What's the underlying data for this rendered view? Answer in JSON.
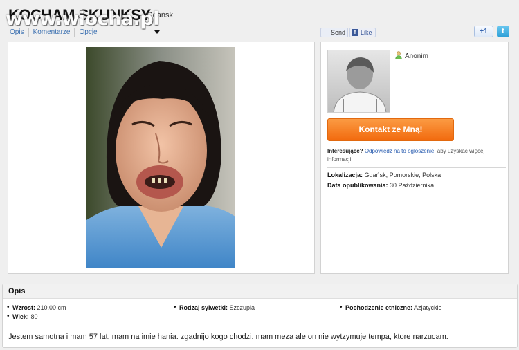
{
  "header": {
    "title": "KOCHAM SKUNKSY",
    "city": "— Gdańsk",
    "watermark": "www.wiocha.pl"
  },
  "tabs": [
    {
      "label": "Opis"
    },
    {
      "label": "Komentarze"
    },
    {
      "label": "Opcje"
    }
  ],
  "social": {
    "send_label": "Send",
    "like_label": "Like",
    "fb_glyph": "f",
    "gplus_label": "+1",
    "twitter_glyph": "t"
  },
  "profile": {
    "username": "Anonim",
    "contact_button": "Kontakt ze Mną!",
    "interest_bold": "Interesujące?",
    "interest_link": "Odpowiedz na to ogłoszenie",
    "interest_text": ", aby uzyskać więcej informacji.",
    "location_label": "Lokalizacja:",
    "location_value": "Gdańsk, Pomorskie, Polska",
    "date_label": "Data opublikowania:",
    "date_value": "30 Października"
  },
  "opis": {
    "heading": "Opis",
    "height_label": "Wzrost:",
    "height_value": "210.00 cm",
    "age_label": "Wiek:",
    "age_value": "80",
    "build_label": "Rodzaj sylwetki:",
    "build_value": "Szczupła",
    "origin_label": "Pochodzenie etniczne:",
    "origin_value": "Azjatyckie",
    "description": "Jestem samotna i mam 57 lat, mam na imie hania. zgadnijo kogo chodzi. mam meza ale on nie wytzymuje tempa, ktore narzucam."
  },
  "colors": {
    "link": "#3a6fb0",
    "button": "#f26a0e",
    "panel_border": "#d2d2d2"
  },
  "icons": [
    "facebook-icon",
    "google-plus-icon",
    "twitter-icon",
    "user-icon",
    "chevron-down-icon"
  ]
}
